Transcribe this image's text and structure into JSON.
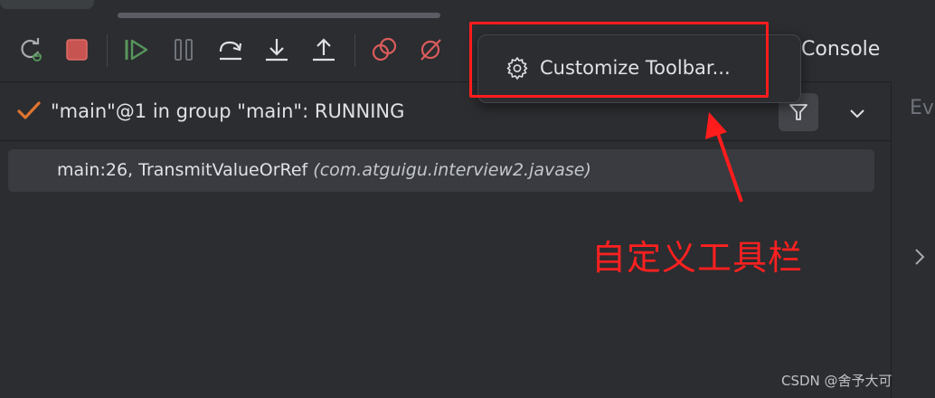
{
  "toolbar": {
    "buttons": [
      {
        "name": "rerun-icon",
        "color": "#a9abb0"
      },
      {
        "name": "stop-icon",
        "color": "#db5c5c"
      },
      {
        "name": "resume-icon",
        "color": "#57965c"
      },
      {
        "name": "pause-icon",
        "color": "#6f737a"
      },
      {
        "name": "step-over-icon",
        "color": "#dfe1e5"
      },
      {
        "name": "step-into-icon",
        "color": "#dfe1e5"
      },
      {
        "name": "step-out-icon",
        "color": "#dfe1e5"
      },
      {
        "name": "view-breakpoints-icon",
        "color": "#db5c5c"
      },
      {
        "name": "mute-breakpoints-icon",
        "color": "#db5c5c"
      }
    ],
    "console_label": "Console"
  },
  "popup": {
    "item_label": "Customize Toolbar...",
    "icon": "gear-icon"
  },
  "thread": {
    "status_icon": "checkmark-icon",
    "text": "\"main\"@1 in group \"main\": RUNNING",
    "status_color": "#e0742e"
  },
  "frames": [
    {
      "location": "main:26, TransmitValueOrRef",
      "package": "(com.atguigu.interview2.javase)"
    }
  ],
  "right_panel": {
    "tab_label": "Ev"
  },
  "annotation": {
    "text": "自定义工具栏",
    "color": "#ff2020"
  },
  "watermark": "CSDN @舍予大可"
}
